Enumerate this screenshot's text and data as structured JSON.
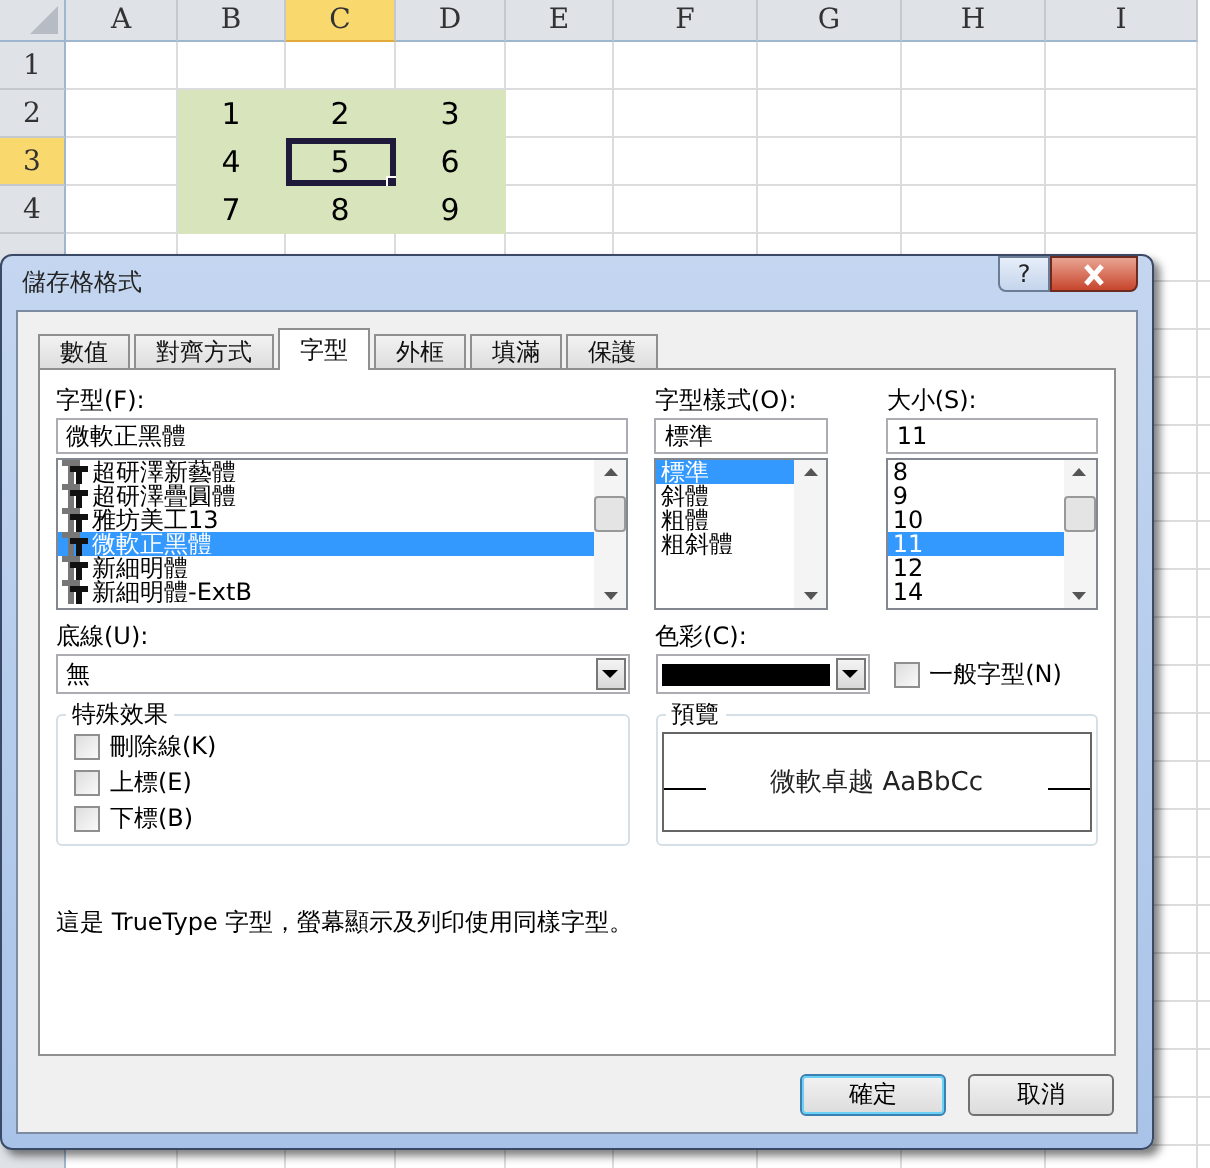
{
  "sheet": {
    "columns": [
      {
        "label": "A",
        "selected": false
      },
      {
        "label": "B",
        "selected": false
      },
      {
        "label": "C",
        "selected": true
      },
      {
        "label": "D",
        "selected": false
      },
      {
        "label": "E",
        "selected": false
      },
      {
        "label": "F",
        "selected": false
      },
      {
        "label": "G",
        "selected": false
      },
      {
        "label": "H",
        "selected": false
      },
      {
        "label": "I",
        "selected": false
      }
    ],
    "rows": [
      {
        "label": "1",
        "selected": false,
        "cells": []
      },
      {
        "label": "2",
        "selected": false,
        "cells": [
          {
            "text": "",
            "selected": false
          },
          {
            "text": "1",
            "selected": false
          },
          {
            "text": "2",
            "selected": false
          },
          {
            "text": "3",
            "selected": false
          }
        ]
      },
      {
        "label": "3",
        "selected": true,
        "cells": [
          {
            "text": "",
            "selected": false
          },
          {
            "text": "4",
            "selected": false
          },
          {
            "text": "5",
            "selected": true
          },
          {
            "text": "6",
            "selected": false
          }
        ]
      },
      {
        "label": "4",
        "selected": false,
        "cells": [
          {
            "text": "",
            "selected": false
          },
          {
            "text": "7",
            "selected": false
          },
          {
            "text": "8",
            "selected": false
          },
          {
            "text": "9",
            "selected": false
          }
        ]
      }
    ]
  },
  "dialog": {
    "title": "儲存格格式",
    "help": "?",
    "tabs": [
      {
        "label": "數值",
        "selected": false
      },
      {
        "label": "對齊方式",
        "selected": false
      },
      {
        "label": "字型",
        "selected": true
      },
      {
        "label": "外框",
        "selected": false
      },
      {
        "label": "填滿",
        "selected": false
      },
      {
        "label": "保護",
        "selected": false
      }
    ],
    "font": {
      "label": "字型(F):",
      "value": "微軟正黑體",
      "items": [
        {
          "label": "超研澤新藝體",
          "selected": false
        },
        {
          "label": "超研澤疊圓體",
          "selected": false
        },
        {
          "label": "雅坊美工13",
          "selected": false
        },
        {
          "label": "微軟正黑體",
          "selected": true
        },
        {
          "label": "新細明體",
          "selected": false
        },
        {
          "label": "新細明體-ExtB",
          "selected": false
        }
      ]
    },
    "style": {
      "label": "字型樣式(O):",
      "value": "標準",
      "items": [
        {
          "label": "標準",
          "selected": true
        },
        {
          "label": "斜體",
          "selected": false
        },
        {
          "label": "粗體",
          "selected": false
        },
        {
          "label": "粗斜體",
          "selected": false
        }
      ]
    },
    "size": {
      "label": "大小(S):",
      "value": "11",
      "items": [
        {
          "label": "8",
          "selected": false
        },
        {
          "label": "9",
          "selected": false
        },
        {
          "label": "10",
          "selected": false
        },
        {
          "label": "11",
          "selected": true
        },
        {
          "label": "12",
          "selected": false
        },
        {
          "label": "14",
          "selected": false
        }
      ]
    },
    "underline": {
      "label": "底線(U):",
      "value": "無"
    },
    "color": {
      "label": "色彩(C):"
    },
    "normal_font": {
      "label": "一般字型(N)",
      "checked": false
    },
    "effects": {
      "title": "特殊效果",
      "items": [
        {
          "label": "刪除線(K)",
          "checked": false
        },
        {
          "label": "上標(E)",
          "checked": false
        },
        {
          "label": "下標(B)",
          "checked": false
        }
      ]
    },
    "preview": {
      "title": "預覽",
      "sample": "微軟卓越 AaBbCc"
    },
    "note": "這是 TrueType 字型，螢幕顯示及列印使用同樣字型。",
    "buttons": [
      {
        "label": "確定",
        "default": true
      },
      {
        "label": "取消",
        "default": false
      }
    ]
  }
}
